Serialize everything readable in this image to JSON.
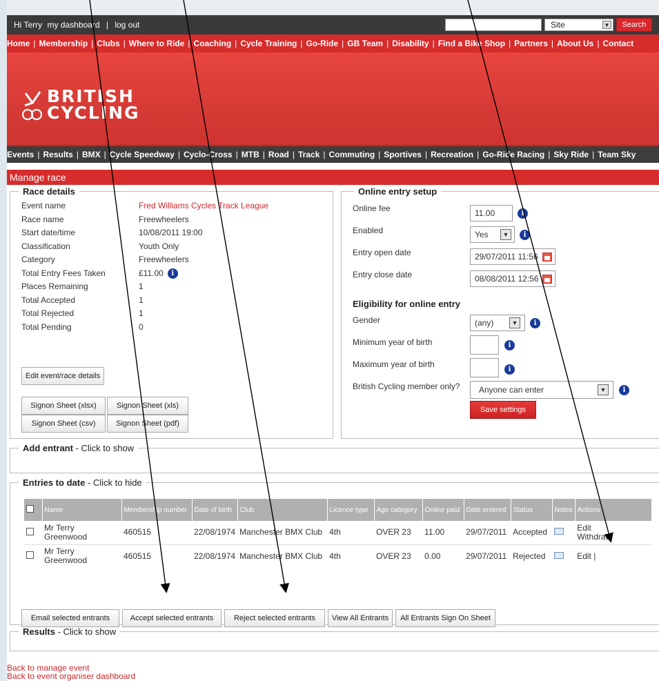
{
  "user_bar": {
    "greeting": "Hi Terry",
    "dashboard": "my dashboard",
    "sep": "|",
    "logout": "log out",
    "search_placeholder": "",
    "site_select": "Site",
    "search_button": "Search"
  },
  "main_nav": [
    "Home",
    "Membership",
    "Clubs",
    "Where to Ride",
    "Coaching",
    "Cycle Training",
    "Go-Ride",
    "GB Team",
    "Disability",
    "Find a Bike Shop",
    "Partners",
    "About Us",
    "Contact"
  ],
  "logo": {
    "line1": "BRITISH",
    "line2": "CYCLING"
  },
  "sub_nav": [
    "Events",
    "Results",
    "BMX",
    "Cycle Speedway",
    "Cyclo-Cross",
    "MTB",
    "Road",
    "Track",
    "Commuting",
    "Sportives",
    "Recreation",
    "Go-Ride Racing",
    "Sky Ride",
    "Team Sky"
  ],
  "page_title": "Manage race",
  "race_details": {
    "legend": "Race details",
    "rows": [
      {
        "label": "Event name",
        "value": "Fred Williams Cycles Track League"
      },
      {
        "label": "Race name",
        "value": "Freewheelers"
      },
      {
        "label": "Start date/time",
        "value": "10/08/2011 19:00"
      },
      {
        "label": "Classification",
        "value": "Youth Only"
      },
      {
        "label": "Category",
        "value": "Freewheelers"
      },
      {
        "label": "Total Entry Fees Taken",
        "value": "£11.00"
      },
      {
        "label": "Places Remaining",
        "value": "1"
      },
      {
        "label": "Total Accepted",
        "value": "1"
      },
      {
        "label": "Total Rejected",
        "value": "1"
      },
      {
        "label": "Total Pending",
        "value": "0"
      }
    ],
    "edit_button": "Edit event/race details",
    "signon_xlsx": "Signon Sheet (xlsx)",
    "signon_xls": "Signon Sheet (xls)",
    "signon_csv": "Signon Sheet (csv)",
    "signon_pdf": "Signon Sheet (pdf)"
  },
  "online_entry": {
    "legend": "Online entry setup",
    "fee_label": "Online fee",
    "fee_value": "11.00",
    "enabled_label": "Enabled",
    "enabled_value": "Yes",
    "open_label": "Entry open date",
    "open_value": "29/07/2011 11:56",
    "close_label": "Entry close date",
    "close_value": "08/08/2011 12:56",
    "eligibility_heading": "Eligibility for online entry",
    "gender_label": "Gender",
    "gender_value": "(any)",
    "min_year_label": "Minimum year of birth",
    "min_year_value": "",
    "max_year_label": "Maximum year of birth",
    "max_year_value": "",
    "member_label": "British Cycling member only?",
    "member_value": "Anyone can enter",
    "save_button": "Save settings"
  },
  "add_entrant": {
    "title": "Add entrant",
    "hint": " - Click to show"
  },
  "entries": {
    "title": "Entries to date",
    "hint": " - Click to hide",
    "headers": [
      "Name",
      "Membership number",
      "Date of birth",
      "Club",
      "Licence type",
      "Age category",
      "Online paid",
      "Date entered",
      "Status",
      "Notes",
      "Actions"
    ],
    "rows": [
      {
        "name": "Mr Terry Greenwood",
        "number": "460515",
        "dob": "22/08/1974",
        "club": "Manchester BMX Club",
        "licence": "4th",
        "age": "OVER 23",
        "paid": "11.00",
        "date": "29/07/2011",
        "status": "Accepted",
        "action1": "Edit",
        "action2": "Withdraw"
      },
      {
        "name": "Mr Terry Greenwood",
        "number": "460515",
        "dob": "22/08/1974",
        "club": "Manchester BMX Club",
        "licence": "4th",
        "age": "OVER 23",
        "paid": "0.00",
        "date": "29/07/2011",
        "status": "Rejected",
        "action1": "Edit |",
        "action2": ""
      }
    ],
    "buttons": {
      "email": "Email selected entrants",
      "accept": "Accept selected entrants",
      "reject": "Reject selected entrants",
      "view_all": "View All Entrants",
      "sign_on": "All Entrants Sign On Sheet"
    }
  },
  "results": {
    "title": "Results",
    "hint": " - Click to show"
  },
  "footer": {
    "back_event": "Back to manage event",
    "back_dashboard": "Back to event organiser dashboard"
  }
}
